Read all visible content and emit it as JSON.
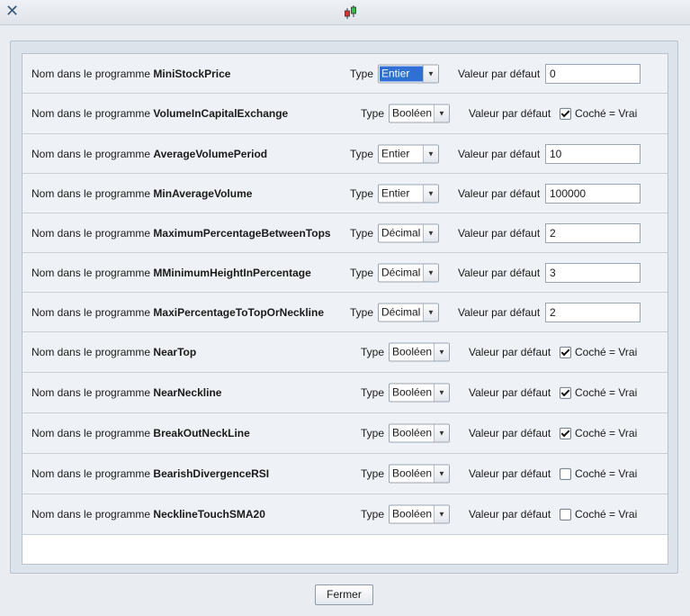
{
  "window": {
    "close_glyph": "✕",
    "icon": "candlestick-icon"
  },
  "labels": {
    "name_prefix": "Nom dans le programme",
    "type": "Type",
    "default": "Valeur par défaut",
    "checked_true": "Coché = Vrai"
  },
  "rows": [
    {
      "name": "MiniStockPrice",
      "type": "Entier",
      "value": "0",
      "selected": true
    },
    {
      "name": "VolumeInCapitalExchange",
      "type": "Booléen",
      "checked": true
    },
    {
      "name": "AverageVolumePeriod",
      "type": "Entier",
      "value": "10"
    },
    {
      "name": "MinAverageVolume",
      "type": "Entier",
      "value": "100000"
    },
    {
      "name": "MaximumPercentageBetweenTops",
      "type": "Décimal",
      "value": "2"
    },
    {
      "name": "MMinimumHeightInPercentage",
      "type": "Décimal",
      "value": "3"
    },
    {
      "name": "MaxiPercentageToTopOrNeckline",
      "type": "Décimal",
      "value": "2"
    },
    {
      "name": "NearTop",
      "type": "Booléen",
      "checked": true
    },
    {
      "name": "NearNeckline",
      "type": "Booléen",
      "checked": true
    },
    {
      "name": "BreakOutNeckLine",
      "type": "Booléen",
      "checked": true
    },
    {
      "name": "BearishDivergenceRSI",
      "type": "Booléen",
      "checked": false
    },
    {
      "name": "NecklineTouchSMA20",
      "type": "Booléen",
      "checked": false
    }
  ],
  "footer": {
    "close_label": "Fermer"
  }
}
